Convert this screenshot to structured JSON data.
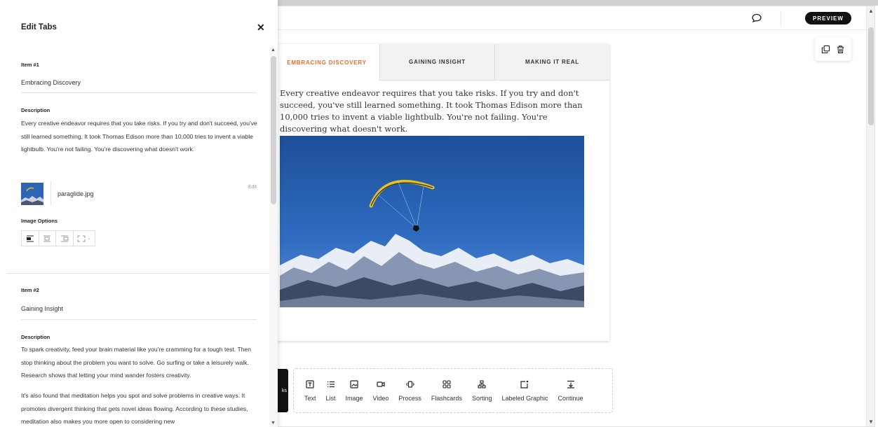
{
  "header": {
    "preview_label": "PREVIEW"
  },
  "tabs": [
    {
      "label": "EMBRACING DISCOVERY",
      "active": true
    },
    {
      "label": "GAINING INSIGHT",
      "active": false
    },
    {
      "label": "MAKING IT REAL",
      "active": false
    }
  ],
  "tab_content": {
    "text": "Every creative endeavor requires that you take risks. If you try and don't succeed, you've still learned something. It took Thomas Edison more than 10,000 tries to invent a viable lightbulb. You're not failing. You're discovering what doesn't work."
  },
  "block_menu": {
    "stub_label": "ks",
    "items": [
      {
        "label": "Text",
        "icon": "text-icon"
      },
      {
        "label": "List",
        "icon": "list-icon"
      },
      {
        "label": "Image",
        "icon": "image-icon"
      },
      {
        "label": "Video",
        "icon": "video-icon"
      },
      {
        "label": "Process",
        "icon": "process-icon"
      },
      {
        "label": "Flashcards",
        "icon": "flashcards-icon"
      },
      {
        "label": "Sorting",
        "icon": "sorting-icon"
      },
      {
        "label": "Labeled Graphic",
        "icon": "labeled-graphic-icon"
      },
      {
        "label": "Continue",
        "icon": "continue-icon"
      }
    ]
  },
  "panel": {
    "title": "Edit Tabs",
    "item1": {
      "heading": "Item #1",
      "title": "Embracing Discovery",
      "desc_label": "Description",
      "description": "Every creative endeavor requires that you take risks. If you try and don't succeed, you've still learned something. It took Thomas Edison more than 10,000 tries to invent a viable lightbulb. You're not failing. You're discovering what doesn't work.",
      "file_name": "paraglide.jpg",
      "edit_label": "Edit",
      "image_options_label": "Image Options"
    },
    "item2": {
      "heading": "Item #2",
      "title": "Gaining Insight",
      "desc_label": "Description",
      "description_p1": "To spark creativity, feed your brain material like you're cramming for a tough test. Then stop thinking about the problem you want to solve. Go surfing or take a leisurely walk. Research shows that letting your mind wander fosters creativity.",
      "description_p2": "It's also found that meditation helps you spot and solve problems in creative ways. It promotes divergent thinking that gets novel ideas flowing. According to these studies, meditation also makes you more open to considering new"
    }
  }
}
